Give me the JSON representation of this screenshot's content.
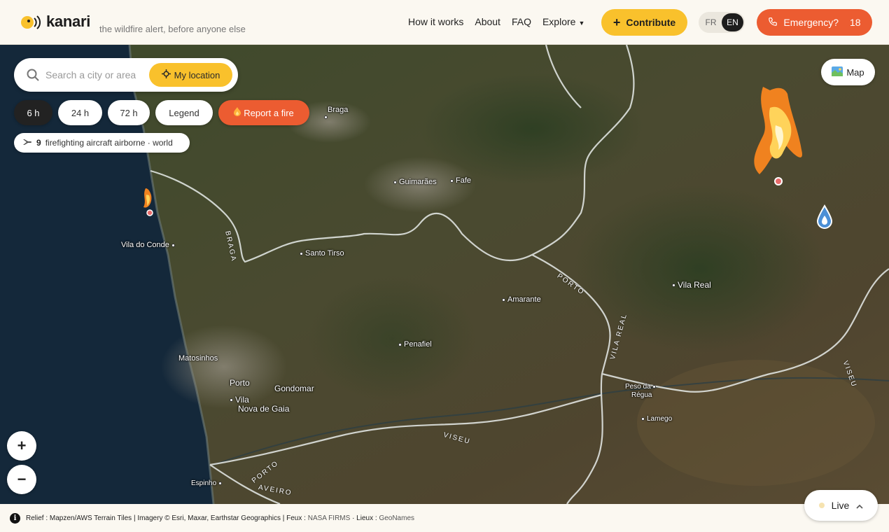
{
  "app": {
    "brand": "kanari",
    "tagline": "the wildfire alert, before anyone else"
  },
  "nav": {
    "how_it_works": "How it works",
    "about": "About",
    "faq": "FAQ",
    "explore": "Explore"
  },
  "actions": {
    "contribute": "Contribute",
    "emergency": "Emergency?",
    "emergency_number": "18"
  },
  "language": {
    "options": [
      "FR",
      "EN"
    ],
    "selected": "EN"
  },
  "search": {
    "placeholder": "Search a city or area",
    "location_button": "My location"
  },
  "time_filters": {
    "h6": "6 h",
    "h24": "24 h",
    "h72": "72 h",
    "selected": "6 h"
  },
  "legend_button": "Legend",
  "report_button": "Report a fire",
  "aircraft": {
    "count": "9",
    "text": "firefighting aircraft airborne · world"
  },
  "map_toggle": "Map",
  "zoom": {
    "in": "+",
    "out": "−"
  },
  "live": {
    "label": "Live"
  },
  "footer": {
    "relief": "Relief : Mapzen/AWS Terrain Tiles | Imagery © Esri, Maxar, Earthstar Geographics | Feux :",
    "firms": "NASA FIRMS",
    "sep": "· Lieux :",
    "geonames": "GeoNames"
  },
  "places": {
    "braga": "Braga",
    "guimaraes": "Guimarães",
    "fafe": "Fafe",
    "vila_do_conde": "Vila do Conde",
    "santo_tirso": "Santo Tirso",
    "amarante": "Amarante",
    "vila_real": "Vila Real",
    "penafiel": "Penafiel",
    "matosinhos": "Matosinhos",
    "porto": "Porto",
    "gondomar": "Gondomar",
    "vila_nova_de_gaia_1": "Vila",
    "vila_nova_de_gaia_2": "Nova de Gaia",
    "peso_da_regua_1": "Peso da",
    "peso_da_regua_2": "Régua",
    "lamego": "Lamego",
    "espinho": "Espinho"
  },
  "regions": {
    "braga": "BRAGA",
    "porto": "PORTO",
    "vila_real": "VILA REAL",
    "viseu_1": "VISEU",
    "viseu_2": "VISEU",
    "porto_south": "PORTO",
    "aveiro": "AVEIRO"
  },
  "colors": {
    "accent_yellow": "#f9c12c",
    "emergency_orange": "#ec5c31",
    "header_bg": "#fbf8f1"
  }
}
